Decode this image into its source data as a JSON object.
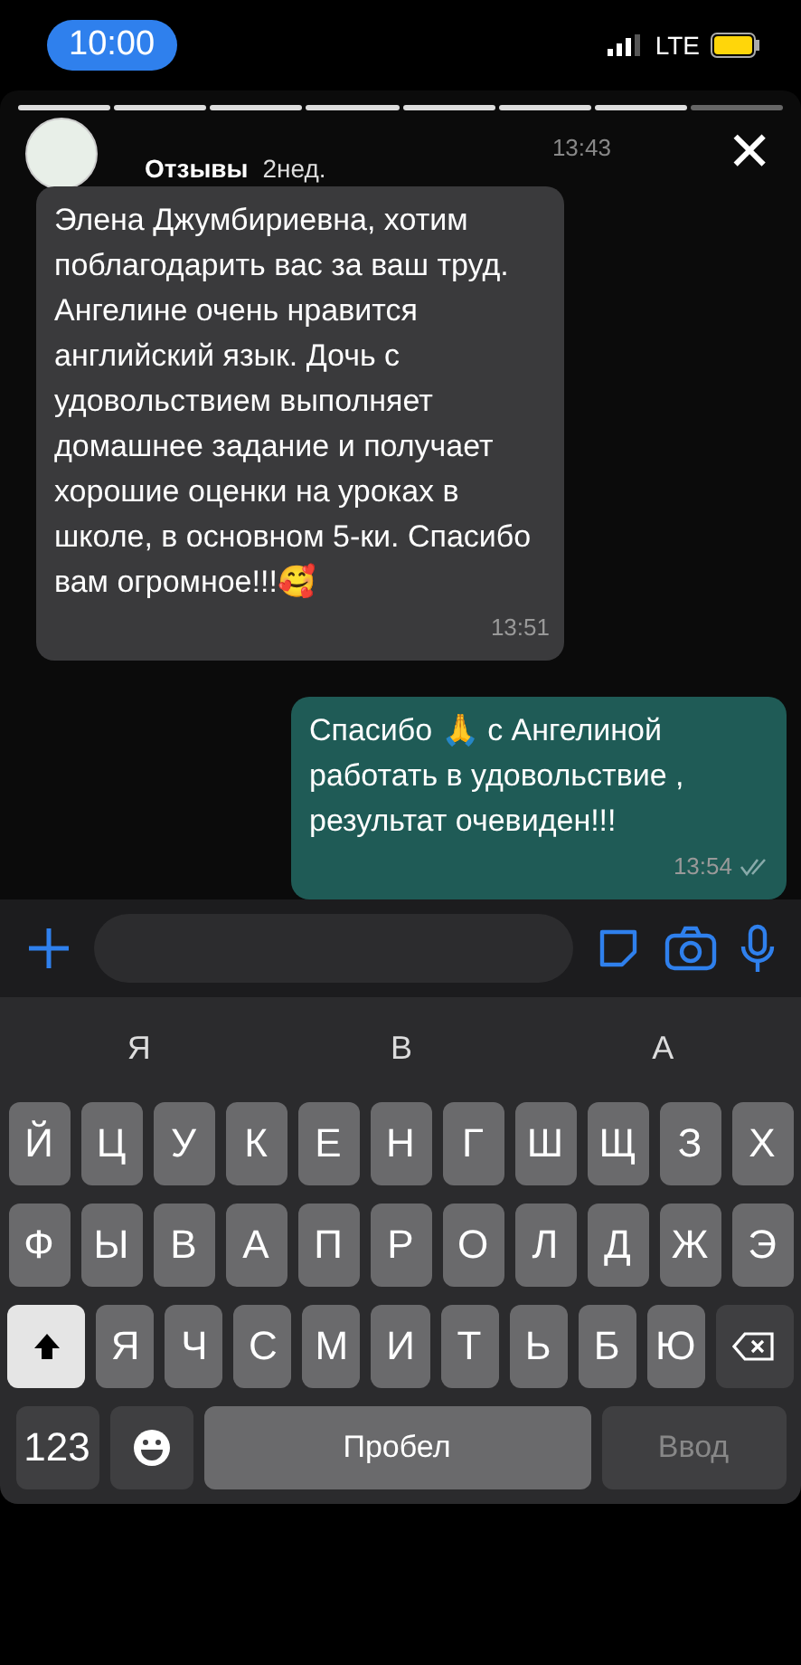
{
  "status_bar": {
    "time": "10:00",
    "network": "LTE"
  },
  "story": {
    "name": "Отзывы",
    "age": "2нед.",
    "previous_time": "13:43",
    "close": "✕"
  },
  "messages": [
    {
      "kind": "incoming",
      "text": "Элена Джумбириевна, хотим поблагодарить вас за ваш труд. Ангелине очень нравится английский язык. Дочь с удовольствием выполняет домашнее задание и получает хорошие оценки на уроках в школе, в основном 5-ки. Спасибо вам огромное!!!🥰",
      "time": "13:51",
      "read": false
    },
    {
      "kind": "outgoing",
      "text": "Спасибо 🙏 с Ангелиной работать в удовольствие , результат очевиден!!!",
      "time": "13:54",
      "read": true
    }
  ],
  "keyboard": {
    "suggestions": [
      "Я",
      "В",
      "А"
    ],
    "top_row": [
      "Й",
      "Ц",
      "У",
      "К",
      "Е",
      "Н",
      "Г",
      "Ш",
      "Щ",
      "З",
      "Х"
    ],
    "middle_row": [
      "Ф",
      "Ы",
      "В",
      "А",
      "П",
      "Р",
      "О",
      "Л",
      "Д",
      "Ж",
      "Э"
    ],
    "bottom_row": [
      "Я",
      "Ч",
      "С",
      "М",
      "И",
      "Т",
      "Ь",
      "Б",
      "Ю"
    ],
    "shift_on": true,
    "numbers": "123",
    "space": "Пробел",
    "enter": "Ввод",
    "enter_disabled": true
  }
}
